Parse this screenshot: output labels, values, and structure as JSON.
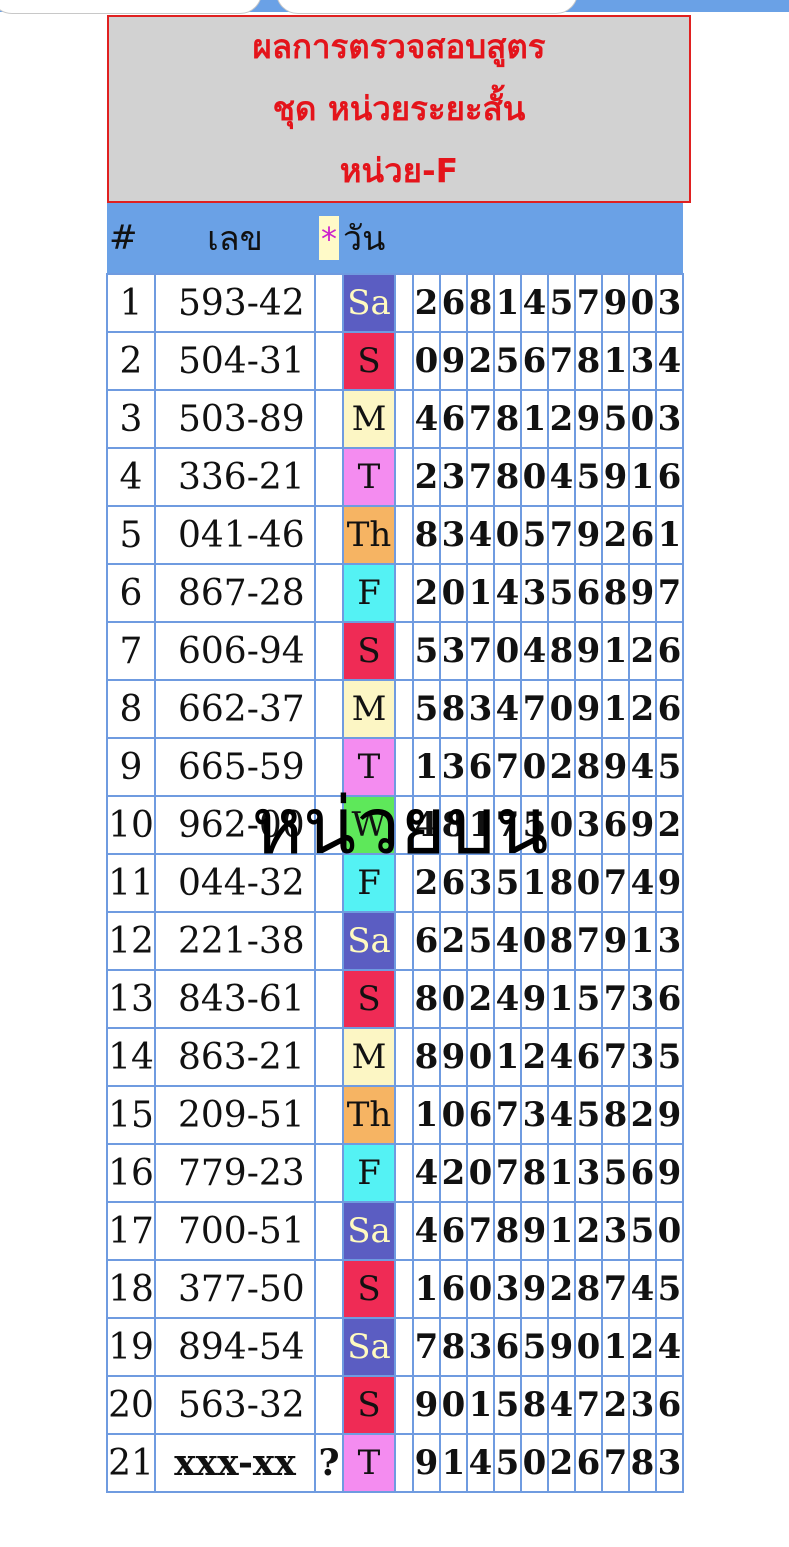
{
  "title": {
    "line1": "ผลการตรวจสอบสูตร",
    "line2": "ชุด หน่วยระยะสั้น",
    "line3": "หน่วย-F"
  },
  "columns": {
    "num": "#",
    "lek": "เลข",
    "star": "*",
    "day": "วัน"
  },
  "watermark": "หน่วยบน",
  "colors": {
    "Sa": "#5b5dc2",
    "S": "#ef2b55",
    "M": "#fcf6c4",
    "T": "#f48cf0",
    "Th": "#f6b463",
    "F": "#54f2f4",
    "W": "#5ee85a",
    "red": "#e4141b"
  },
  "rows": [
    {
      "num": "1",
      "lek": "593-42",
      "day": "Sa",
      "digits": "2681457903",
      "red": [
        9
      ]
    },
    {
      "num": "2",
      "lek": "504-31",
      "day": "S",
      "digits": "0925678134",
      "red": [
        9
      ]
    },
    {
      "num": "3",
      "lek": "503-89",
      "day": "M",
      "digits": "4678129503",
      "red": [
        9
      ]
    },
    {
      "num": "4",
      "lek": "336-21",
      "day": "T",
      "digits": "2378045916",
      "red": [
        9
      ]
    },
    {
      "num": "5",
      "lek": "041-46",
      "day": "Th",
      "digits": "8340579261",
      "red": [
        9
      ]
    },
    {
      "num": "6",
      "lek": "867-28",
      "day": "F",
      "digits": "2014356897",
      "red": [
        9
      ]
    },
    {
      "num": "7",
      "lek": "606-94",
      "day": "S",
      "digits": "5370489126",
      "red": [
        9
      ]
    },
    {
      "num": "8",
      "lek": "662-37",
      "day": "M",
      "digits": "5834709126",
      "red": [
        8
      ]
    },
    {
      "num": "9",
      "lek": "665-59",
      "day": "T",
      "digits": "1367028945",
      "red": [
        9
      ]
    },
    {
      "num": "10",
      "lek": "962-00",
      "day": "W",
      "digits": "4817503692",
      "red": [
        9
      ]
    },
    {
      "num": "11",
      "lek": "044-32",
      "day": "F",
      "digits": "2635180749",
      "red": [
        8
      ]
    },
    {
      "num": "12",
      "lek": "221-38",
      "day": "Sa",
      "digits": "6254087913",
      "red": [
        8
      ]
    },
    {
      "num": "13",
      "lek": "843-61",
      "day": "S",
      "digits": "8024915736",
      "red": [
        8
      ]
    },
    {
      "num": "14",
      "lek": "863-21",
      "day": "M",
      "digits": "8901246735",
      "red": [
        8
      ]
    },
    {
      "num": "15",
      "lek": "209-51",
      "day": "Th",
      "digits": "1067345829",
      "red": [
        9
      ]
    },
    {
      "num": "16",
      "lek": "779-23",
      "day": "F",
      "digits": "4207813569",
      "red": [
        9
      ]
    },
    {
      "num": "17",
      "lek": "700-51",
      "day": "Sa",
      "digits": "4678912350",
      "red": [
        9
      ]
    },
    {
      "num": "18",
      "lek": "377-50",
      "day": "S",
      "digits": "1603928745",
      "red": [
        6
      ]
    },
    {
      "num": "19",
      "lek": "894-54",
      "day": "Sa",
      "digits": "7836590124",
      "red": [
        9
      ]
    },
    {
      "num": "20",
      "lek": "563-32",
      "day": "S",
      "digits": "9015847236",
      "red": [
        8
      ]
    },
    {
      "num": "21",
      "lek": "xxx-xx",
      "star": "?",
      "day": "T",
      "digits": "9145026783",
      "red": []
    }
  ]
}
